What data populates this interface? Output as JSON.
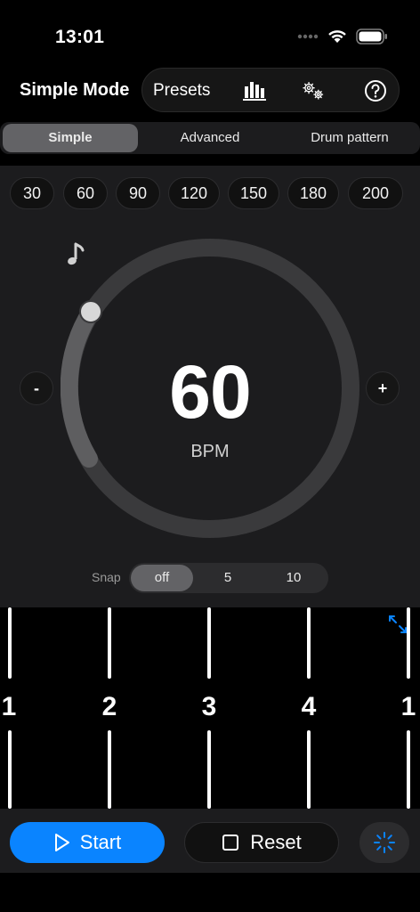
{
  "status": {
    "time": "13:01"
  },
  "header": {
    "title": "Simple Mode",
    "presets_label": "Presets",
    "icons": [
      "bar-chart-icon",
      "gears-icon",
      "help-icon"
    ]
  },
  "mode_tabs": [
    {
      "label": "Simple",
      "active": true
    },
    {
      "label": "Advanced",
      "active": false
    },
    {
      "label": "Drum pattern",
      "active": false
    }
  ],
  "tempo_presets": [
    "30",
    "60",
    "90",
    "120",
    "150",
    "180",
    "200"
  ],
  "dial": {
    "value": "60",
    "unit": "BPM",
    "minus_label": "-",
    "plus_label": "+",
    "note_icon": "music-note-icon"
  },
  "snap": {
    "label": "Snap",
    "options": [
      "off",
      "5",
      "10"
    ],
    "selected": "off"
  },
  "beats": [
    "1",
    "2",
    "3",
    "4",
    "1"
  ],
  "controls": {
    "start_label": "Start",
    "reset_label": "Reset",
    "accent_color": "#0a84ff"
  }
}
